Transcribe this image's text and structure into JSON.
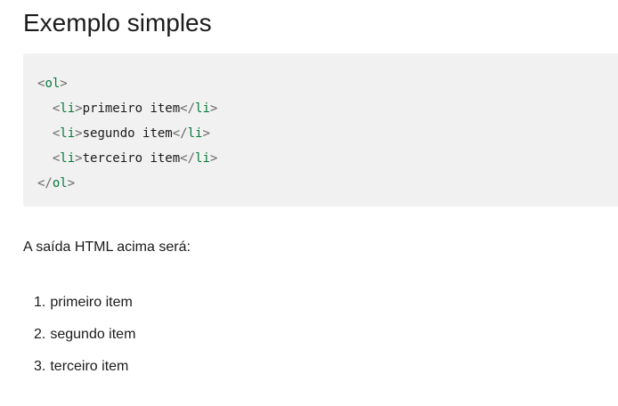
{
  "heading": "Exemplo simples",
  "code": {
    "lines": [
      {
        "indent": "",
        "open": "ol",
        "text": "",
        "close": ""
      },
      {
        "indent": "  ",
        "open": "li",
        "text": "primeiro item",
        "close": "li"
      },
      {
        "indent": "  ",
        "open": "li",
        "text": "segundo item",
        "close": "li"
      },
      {
        "indent": "  ",
        "open": "li",
        "text": "terceiro item",
        "close": "li"
      },
      {
        "indent": "",
        "open": "",
        "text": "",
        "close": "ol"
      }
    ],
    "colors": {
      "background": "#f2f1f1",
      "tag": "#067a3b",
      "punctuation": "#696969",
      "text": "#1b1b1b"
    }
  },
  "description": "A saída HTML acima será:",
  "output_list": [
    {
      "number": "1.",
      "label": "primeiro item"
    },
    {
      "number": "2.",
      "label": "segundo item"
    },
    {
      "number": "3.",
      "label": "terceiro item"
    }
  ]
}
